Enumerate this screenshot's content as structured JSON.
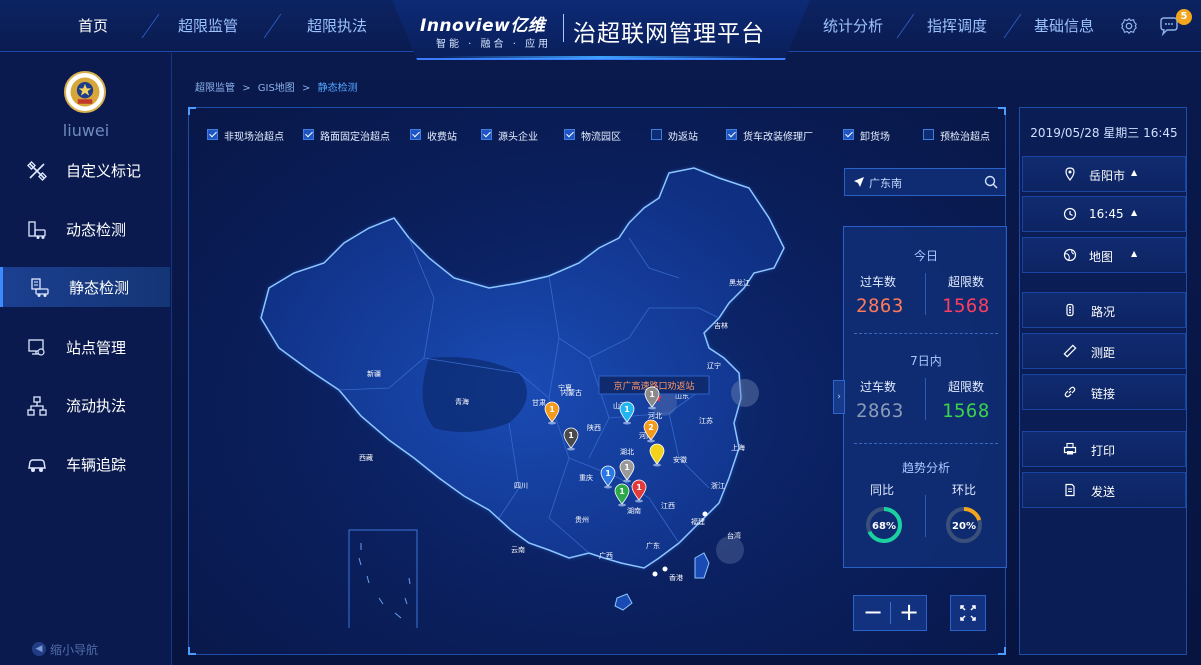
{
  "header": {
    "nav_left": [
      "首页",
      "超限监管",
      "超限执法"
    ],
    "brand_logo": "Innoview亿维",
    "brand_sub": "智能 · 融合 · 应用",
    "brand_title": "治超联网管理平台",
    "nav_right": [
      "统计分析",
      "指挥调度",
      "基础信息"
    ],
    "message_badge": "5",
    "icons": [
      "gear-icon",
      "chat-icon"
    ]
  },
  "sidebar": {
    "username": "liuwei",
    "items": [
      {
        "label": "自定义标记",
        "icon": "custom-mark-icon"
      },
      {
        "label": "动态检测",
        "icon": "dynamic-detect-icon"
      },
      {
        "label": "静态检测",
        "icon": "static-detect-icon",
        "active": true
      },
      {
        "label": "站点管理",
        "icon": "site-manage-icon"
      },
      {
        "label": "流动执法",
        "icon": "mobile-enforce-icon"
      },
      {
        "label": "车辆追踪",
        "icon": "vehicle-track-icon"
      }
    ],
    "collapse_label": "缩小导航"
  },
  "breadcrumb": {
    "items": [
      "超限监管",
      "GIS地图",
      "静态检测"
    ],
    "separator": ">"
  },
  "filters": [
    {
      "label": "非现场治超点",
      "checked": true
    },
    {
      "label": "路面固定治超点",
      "checked": true
    },
    {
      "label": "收费站",
      "checked": true
    },
    {
      "label": "源头企业",
      "checked": true
    },
    {
      "label": "物流园区",
      "checked": true
    },
    {
      "label": "劝返站",
      "checked": false
    },
    {
      "label": "货车改装修理厂",
      "checked": true
    },
    {
      "label": "卸货场",
      "checked": true
    },
    {
      "label": "预检治超点",
      "checked": false
    }
  ],
  "map": {
    "provinces": [
      "黑龙江",
      "吉林",
      "辽宁",
      "内蒙古",
      "北京",
      "天津",
      "河北",
      "新疆",
      "青海",
      "甘肃",
      "宁夏",
      "山西",
      "山东",
      "陕西",
      "河南",
      "江苏",
      "上海",
      "西藏",
      "四川",
      "重庆",
      "湖北",
      "安徽",
      "浙江",
      "贵州",
      "湖南",
      "江西",
      "福建",
      "台湾",
      "云南",
      "广西",
      "广东",
      "香港"
    ],
    "tooltip": "京广高速路口劝返站",
    "pins": [
      {
        "label": "1",
        "color": "#f39a1c"
      },
      {
        "label": "1",
        "color": "#8a8a8a"
      },
      {
        "label": "1",
        "color": "#1fb6f2"
      },
      {
        "label": "2",
        "color": "#f39a1c"
      },
      {
        "label": "1",
        "color": "#4a4a4a"
      },
      {
        "label": "",
        "color": "#f3d21c"
      },
      {
        "label": "1",
        "color": "#2a78e8"
      },
      {
        "label": "1",
        "color": "#9a9a9a"
      },
      {
        "label": "1",
        "color": "#2fa84a"
      },
      {
        "label": "1",
        "color": "#e23a3a"
      }
    ]
  },
  "search": {
    "value": "广东南",
    "icons": [
      "location-arrow-icon",
      "search-icon"
    ]
  },
  "stats": {
    "today": {
      "title": "今日",
      "pass_label": "过车数",
      "over_label": "超限数",
      "pass": "2863",
      "over": "1568",
      "pass_color": "#ff7a57",
      "over_color": "#ff3d5e"
    },
    "week": {
      "title": "7日内",
      "pass_label": "过车数",
      "over_label": "超限数",
      "pass": "2863",
      "over": "1568",
      "pass_color": "#8a9bb8",
      "over_color": "#3ad24a"
    },
    "trend": {
      "title": "趋势分析",
      "yoy_label": "同比",
      "mom_label": "环比",
      "yoy": "68%",
      "mom": "20%",
      "yoy_value": 0.68,
      "mom_value": 0.2,
      "yoy_color": "#19d2a0",
      "mom_color": "#f3a51b"
    }
  },
  "zoom": {
    "minus": "−",
    "plus": "+"
  },
  "right_panel": {
    "datetime": "2019/05/28  星期三 16:45",
    "buttons": [
      {
        "label": "岳阳市",
        "icon": "location-pin-icon",
        "caret": true
      },
      {
        "label": "16:45",
        "icon": "clock-icon",
        "caret": true
      },
      {
        "label": "地图",
        "icon": "globe-icon",
        "caret": true
      },
      {
        "label": "路况",
        "icon": "traffic-icon",
        "caret": false
      },
      {
        "label": "测距",
        "icon": "ruler-icon",
        "caret": false
      },
      {
        "label": "链接",
        "icon": "link-icon",
        "caret": false
      },
      {
        "label": "打印",
        "icon": "print-icon",
        "caret": false
      },
      {
        "label": "发送",
        "icon": "send-icon",
        "caret": false
      }
    ]
  }
}
